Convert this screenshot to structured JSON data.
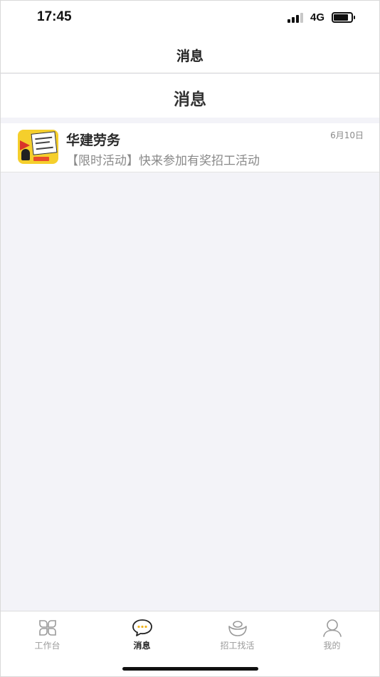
{
  "status_bar": {
    "time": "17:45",
    "network": "4G",
    "signal_icon": "signal-bars-icon",
    "battery_icon": "battery-icon"
  },
  "nav": {
    "title": "消息"
  },
  "page": {
    "title": "消息"
  },
  "messages": [
    {
      "name": "华建劳务",
      "preview": "【限时活动】快来参加有奖招工活动",
      "date": "6月10日",
      "avatar_icon": "recruitment-megaphone-avatar"
    }
  ],
  "tab_bar": {
    "tabs": [
      {
        "label": "工作台",
        "icon": "grid-petals-icon",
        "active": false
      },
      {
        "label": "消息",
        "icon": "chat-bubble-icon",
        "active": true
      },
      {
        "label": "招工找活",
        "icon": "ingot-icon",
        "active": false
      },
      {
        "label": "我的",
        "icon": "person-icon",
        "active": false
      }
    ]
  },
  "colors": {
    "background": "#f3f3f8",
    "surface": "#ffffff",
    "active_tab": "#222222",
    "inactive_tab": "#9a9a9a",
    "chat_dots": "#f0b31f",
    "avatar_yellow": "#f5cf2c"
  }
}
